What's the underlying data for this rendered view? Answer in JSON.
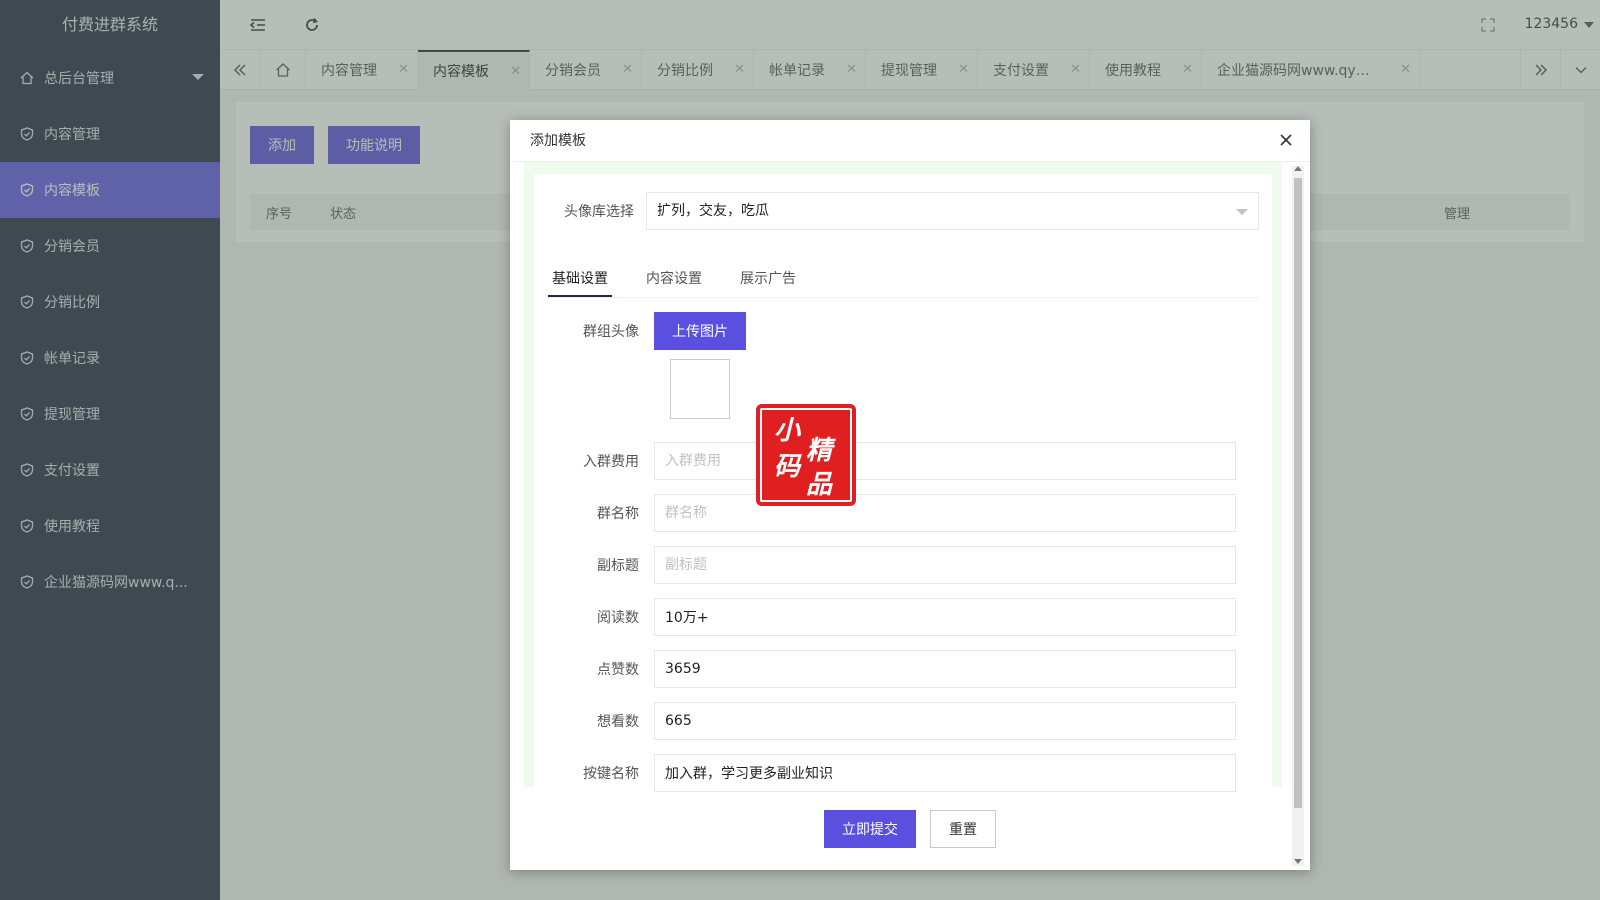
{
  "app": {
    "title": "付费进群系统"
  },
  "sidebar": {
    "items": [
      {
        "label": "总后台管理",
        "icon": "home-icon"
      },
      {
        "label": "内容管理",
        "icon": "shield-check-icon"
      },
      {
        "label": "内容模板",
        "icon": "shield-check-icon",
        "active": true
      },
      {
        "label": "分销会员",
        "icon": "shield-check-icon"
      },
      {
        "label": "分销比例",
        "icon": "shield-check-icon"
      },
      {
        "label": "帐单记录",
        "icon": "shield-check-icon"
      },
      {
        "label": "提现管理",
        "icon": "shield-check-icon"
      },
      {
        "label": "支付设置",
        "icon": "shield-check-icon"
      },
      {
        "label": "使用教程",
        "icon": "shield-check-icon"
      },
      {
        "label": "企业猫源码网www.q...",
        "icon": "shield-check-icon"
      }
    ]
  },
  "header": {
    "user": "123456"
  },
  "tabs": [
    {
      "label": "内容管理"
    },
    {
      "label": "内容模板",
      "active": true
    },
    {
      "label": "分销会员"
    },
    {
      "label": "分销比例"
    },
    {
      "label": "帐单记录"
    },
    {
      "label": "提现管理"
    },
    {
      "label": "支付设置"
    },
    {
      "label": "使用教程"
    },
    {
      "label": "企业猫源码网www.qym..."
    }
  ],
  "page": {
    "add_label": "添加",
    "doc_label": "功能说明",
    "table_headers": {
      "index": "序号",
      "status": "状态",
      "manage": "管理"
    }
  },
  "modal": {
    "title": "添加模板",
    "avatar_lib": {
      "label": "头像库选择",
      "value": "扩列，交友，吃瓜"
    },
    "subtabs": [
      "基础设置",
      "内容设置",
      "展示广告"
    ],
    "group_avatar": {
      "label": "群组头像",
      "button": "上传图片"
    },
    "fields": {
      "fee": {
        "label": "入群费用",
        "value": "",
        "placeholder": "入群费用"
      },
      "name": {
        "label": "群名称",
        "value": "",
        "placeholder": "群名称"
      },
      "subtitle": {
        "label": "副标题",
        "value": "",
        "placeholder": "副标题"
      },
      "reads": {
        "label": "阅读数",
        "value": "10万+"
      },
      "likes": {
        "label": "点赞数",
        "value": "3659"
      },
      "wants": {
        "label": "想看数",
        "value": "665"
      },
      "button_name": {
        "label": "按键名称",
        "value": "加入群，学习更多副业知识"
      }
    },
    "submit": "立即提交",
    "reset": "重置"
  },
  "watermark": {
    "chars": [
      "小",
      "精",
      "码",
      "品"
    ]
  },
  "colors": {
    "sidebar": "#232a47",
    "accent": "#5b4fe0",
    "stamp": "#e02020"
  }
}
